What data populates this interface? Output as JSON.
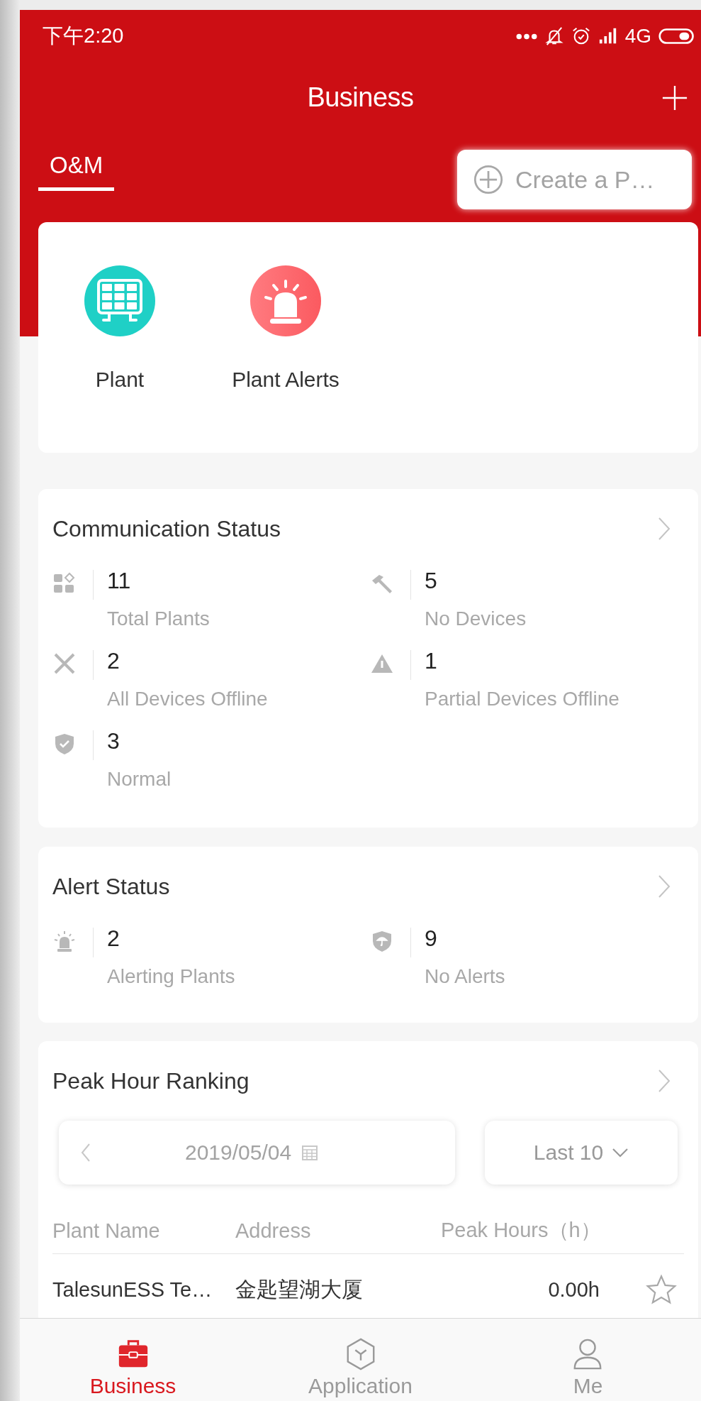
{
  "status_bar": {
    "time": "下午2:20",
    "network": "4G"
  },
  "header": {
    "title": "Business"
  },
  "tabs": [
    {
      "label": "O&M",
      "selected": true
    }
  ],
  "create_button": {
    "label": "Create a P…"
  },
  "shortcuts": [
    {
      "kind": "solar",
      "label": "Plant"
    },
    {
      "kind": "siren",
      "label": "Plant Alerts"
    }
  ],
  "communication_status": {
    "title": "Communication Status",
    "items": [
      {
        "kind": "total",
        "value": "11",
        "label": "Total Plants"
      },
      {
        "kind": "no_devices",
        "value": "5",
        "label": "No Devices"
      },
      {
        "kind": "offline",
        "value": "2",
        "label": "All Devices Offline"
      },
      {
        "kind": "partial",
        "value": "1",
        "label": "Partial Devices Offline"
      },
      {
        "kind": "normal",
        "value": "3",
        "label": "Normal"
      }
    ]
  },
  "alert_status": {
    "title": "Alert Status",
    "items": [
      {
        "kind": "alerting",
        "value": "2",
        "label": "Alerting Plants"
      },
      {
        "kind": "no_alerts",
        "value": "9",
        "label": "No Alerts"
      }
    ]
  },
  "peak_hour_ranking": {
    "title": "Peak Hour Ranking",
    "date": "2019/05/04",
    "range": "Last 10",
    "columns": [
      "Plant Name",
      "Address",
      "Peak Hours（h）"
    ],
    "rows": [
      {
        "name": "TalesunESS Te…",
        "address": "金匙望湖大厦",
        "hours": "0.00h",
        "starred": false
      }
    ]
  },
  "nav": [
    {
      "kind": "business",
      "label": "Business",
      "selected": true
    },
    {
      "kind": "application",
      "label": "Application",
      "selected": false
    },
    {
      "kind": "me",
      "label": "Me",
      "selected": false
    }
  ]
}
